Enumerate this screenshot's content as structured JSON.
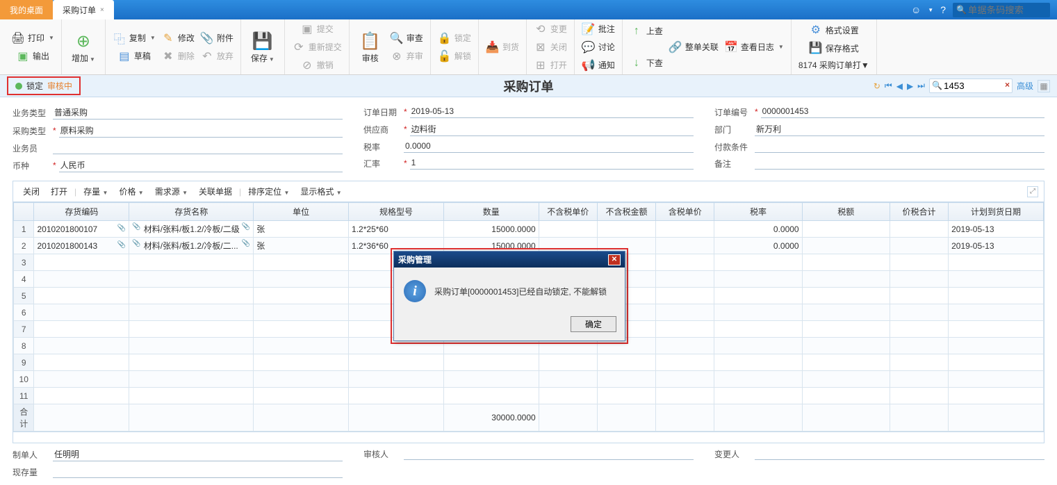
{
  "header": {
    "tab_desktop": "我的桌面",
    "tab_active": "采购订单",
    "search_placeholder": "单据条码搜索"
  },
  "toolbar": {
    "print": "打印",
    "export": "输出",
    "add": "增加",
    "copy": "复制",
    "draft": "草稿",
    "modify": "修改",
    "delete": "删除",
    "attach": "附件",
    "abandon": "放弃",
    "save": "保存",
    "submit": "提交",
    "resubmit": "重新提交",
    "revoke": "撤销",
    "audit": "审核",
    "unaudit": "弃审",
    "review": "审查",
    "lock": "锁定",
    "unlock": "解锁",
    "arrival": "到货",
    "change": "变更",
    "close": "关闭",
    "open": "打开",
    "note": "批注",
    "discuss": "讨论",
    "notify": "通知",
    "upcheck": "上查",
    "downcheck": "下查",
    "whole_link": "整单关联",
    "view_log": "查看日志",
    "format_set": "格式设置",
    "save_format": "保存格式",
    "print_format": "8174 采购订单打▼"
  },
  "status": {
    "locked": "锁定",
    "review": "审核中",
    "title": "采购订单",
    "record": "1453",
    "adv": "高级"
  },
  "form": {
    "l1": "业务类型",
    "v1": "普通采购",
    "l2": "采购类型",
    "v2": "原料采购",
    "l3": "业务员",
    "v3": "",
    "l4": "币种",
    "v4": "人民币",
    "m1": "订单日期",
    "mv1": "2019-05-13",
    "m2": "供应商",
    "mv2": "边料街",
    "m3": "税率",
    "mv3": "0.0000",
    "m4": "汇率",
    "mv4": "1",
    "r1": "订单编号",
    "rv1": "0000001453",
    "r2": "部门",
    "rv2": "新万利",
    "r3": "付款条件",
    "rv3": "",
    "r4": "备注",
    "rv4": ""
  },
  "grid_toolbar": {
    "close": "关闭",
    "open": "打开",
    "stock": "存量",
    "price": "价格",
    "demand": "需求源",
    "linked": "关联单据",
    "sort": "排序定位",
    "fmt": "显示格式"
  },
  "grid": {
    "headers": [
      "存货编码",
      "存货名称",
      "单位",
      "规格型号",
      "数量",
      "不含税单价",
      "不含税金额",
      "含税单价",
      "税率",
      "税额",
      "价税合计",
      "计划到货日期"
    ],
    "rows": [
      {
        "n": "1",
        "code": "2010201800107",
        "name": "材料/张料/板1.2/冷板/二级",
        "unit": "张",
        "spec": "1.2*25*60",
        "qty": "15000.0000",
        "rate": "0.0000",
        "date": "2019-05-13"
      },
      {
        "n": "2",
        "code": "2010201800143",
        "name": "材料/张料/板1.2/冷板/二...",
        "unit": "张",
        "spec": "1.2*36*60",
        "qty": "15000.0000",
        "rate": "0.0000",
        "date": "2019-05-13"
      }
    ],
    "sum_label": "合计",
    "sum_qty": "30000.0000"
  },
  "footer": {
    "l1": "制单人",
    "v1": "任明明",
    "l2": "现存量",
    "v2": "",
    "m1": "审核人",
    "mv1": "",
    "r1": "变更人",
    "rv1": ""
  },
  "dialog": {
    "title": "采购管理",
    "message": "采购订单[0000001453]已经自动锁定, 不能解锁",
    "ok": "确定"
  }
}
